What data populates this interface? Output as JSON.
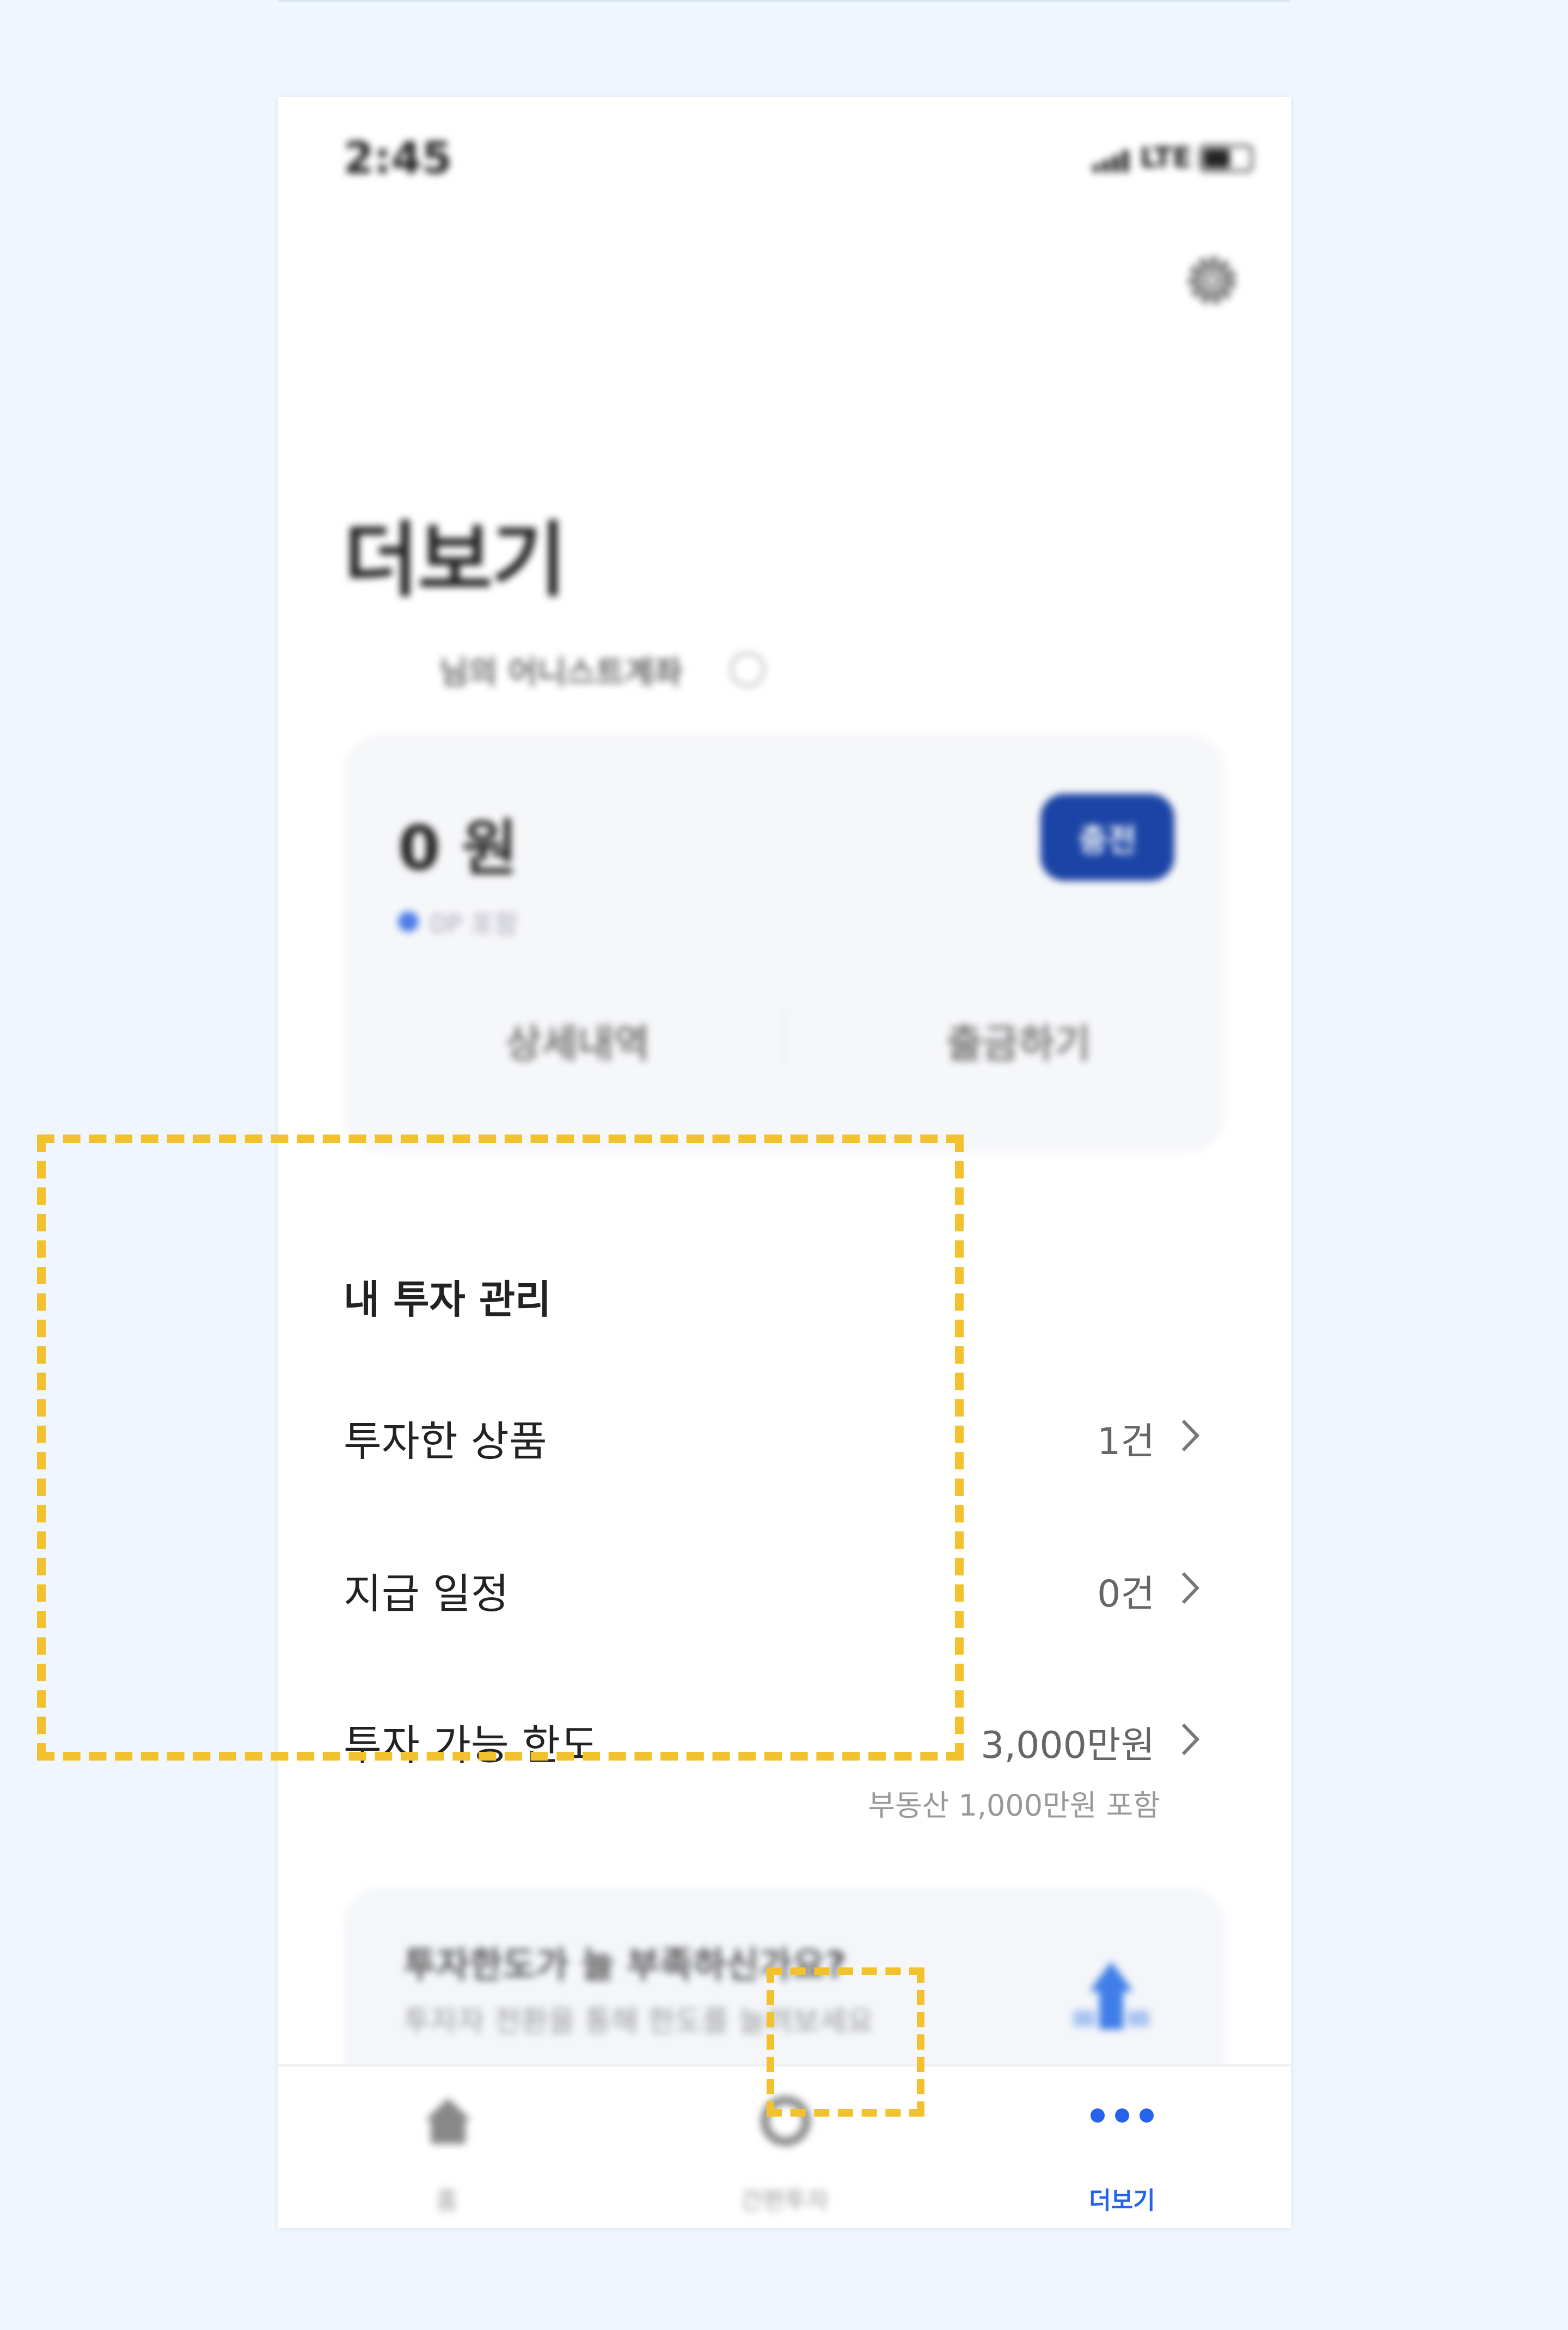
{
  "status_bar": {
    "time": "2:45",
    "network": "LTE"
  },
  "header": {
    "title": "더보기",
    "settings_icon": "gear-icon"
  },
  "account": {
    "label": "님의 어니스트계좌",
    "balance": "0 원",
    "points_note": "0P 포함",
    "charge_button": "충전",
    "detail_action": "상세내역",
    "withdraw_action": "출금하기"
  },
  "investment": {
    "section_title": "내 투자 관리",
    "rows": [
      {
        "label": "투자한 상품",
        "value": "1건"
      },
      {
        "label": "지급 일정",
        "value": "0건"
      },
      {
        "label": "투자 가능 한도",
        "value": "3,000만원",
        "sub": "부동산 1,000만원 포함"
      }
    ]
  },
  "promo": {
    "title": "투자한도가 늘 부족하신가요?",
    "subtitle": "투자자 전환을 통해 한도를 늘려보세요"
  },
  "tabs": [
    {
      "label": "홈",
      "icon": "home-icon"
    },
    {
      "label": "간편투자",
      "icon": "won-coin-icon"
    },
    {
      "label": "더보기",
      "icon": "more-dots-icon",
      "active": true
    }
  ],
  "colors": {
    "accent": "#2563eb",
    "charge_button": "#1b44a6",
    "highlight": "#f1c22e"
  }
}
